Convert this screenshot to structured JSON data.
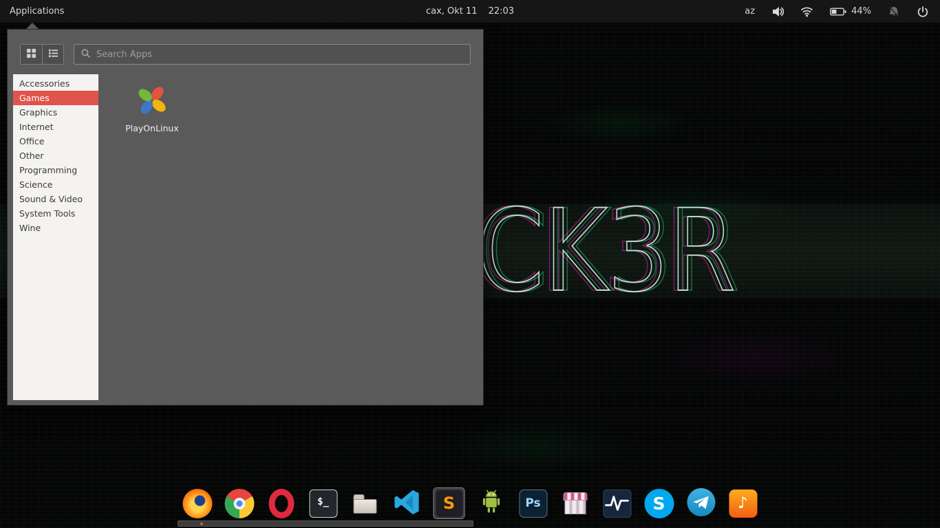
{
  "panel": {
    "applications_label": "Applications",
    "clock_date": "cax, Okt 11",
    "clock_time": "22:03",
    "keyboard_layout": "az",
    "battery_percent": "44%",
    "battery_level": 44
  },
  "app_menu": {
    "search_placeholder": "Search Apps",
    "categories": [
      "Accessories",
      "Games",
      "Graphics",
      "Internet",
      "Office",
      "Other",
      "Programming",
      "Science",
      "Sound & Video",
      "System Tools",
      "Wine"
    ],
    "selected_category": "Games",
    "selected_category_color": "#e0544c",
    "apps": [
      {
        "name": "PlayOnLinux",
        "icon": "playonlinux-icon"
      }
    ]
  },
  "wallpaper": {
    "glitch_text": "CK3R"
  },
  "dock": {
    "items": [
      "firefox",
      "chrome",
      "opera",
      "terminal",
      "file-manager",
      "vscode",
      "sublime-text",
      "android-studio",
      "photoshop",
      "software-store",
      "activity-monitor",
      "skype",
      "telegram",
      "music-player"
    ],
    "focused_item": "sublime-text",
    "glyphs": {
      "terminal": "$_",
      "photoshop": "Ps",
      "skype": "S",
      "sublime": "S",
      "music": "♪"
    }
  },
  "colors": {
    "panel_bg": "#161616",
    "menu_bg": "#5a5a5a",
    "sidebar_bg": "#f4f3f1",
    "accent_red": "#e0544c"
  }
}
